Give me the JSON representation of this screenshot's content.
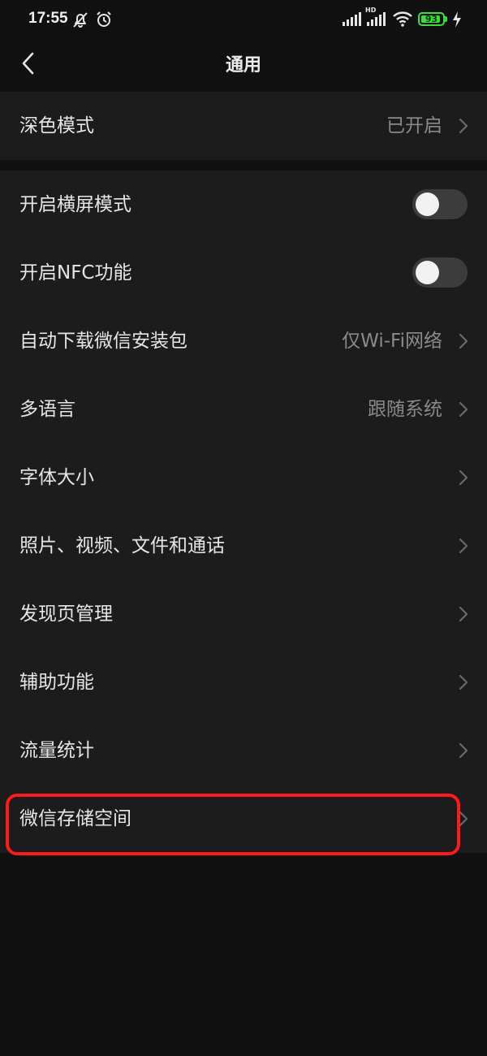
{
  "status_bar": {
    "time": "17:55",
    "battery_level": "93",
    "battery_percent": 93,
    "network_label": "HD",
    "icons": [
      "mute-icon",
      "alarm-icon",
      "signal-icon",
      "hd-signal-icon",
      "wifi-icon",
      "battery-icon",
      "charging-icon"
    ],
    "battery_color": "#3ddc3d"
  },
  "nav": {
    "title": "通用",
    "back_icon": "back-chevron-icon"
  },
  "settings": {
    "dark_mode": {
      "label": "深色模式",
      "value": "已开启"
    },
    "landscape": {
      "label": "开启横屏模式",
      "enabled": false
    },
    "nfc": {
      "label": "开启NFC功能",
      "enabled": false
    },
    "auto_download": {
      "label": "自动下载微信安装包",
      "value": "仅Wi-Fi网络"
    },
    "language": {
      "label": "多语言",
      "value": "跟随系统"
    },
    "font_size": {
      "label": "字体大小"
    },
    "media": {
      "label": "照片、视频、文件和通话"
    },
    "discover": {
      "label": "发现页管理"
    },
    "accessibility": {
      "label": "辅助功能"
    },
    "traffic": {
      "label": "流量统计"
    },
    "storage": {
      "label": "微信存储空间"
    }
  },
  "highlight_color": "#ff1a1a"
}
